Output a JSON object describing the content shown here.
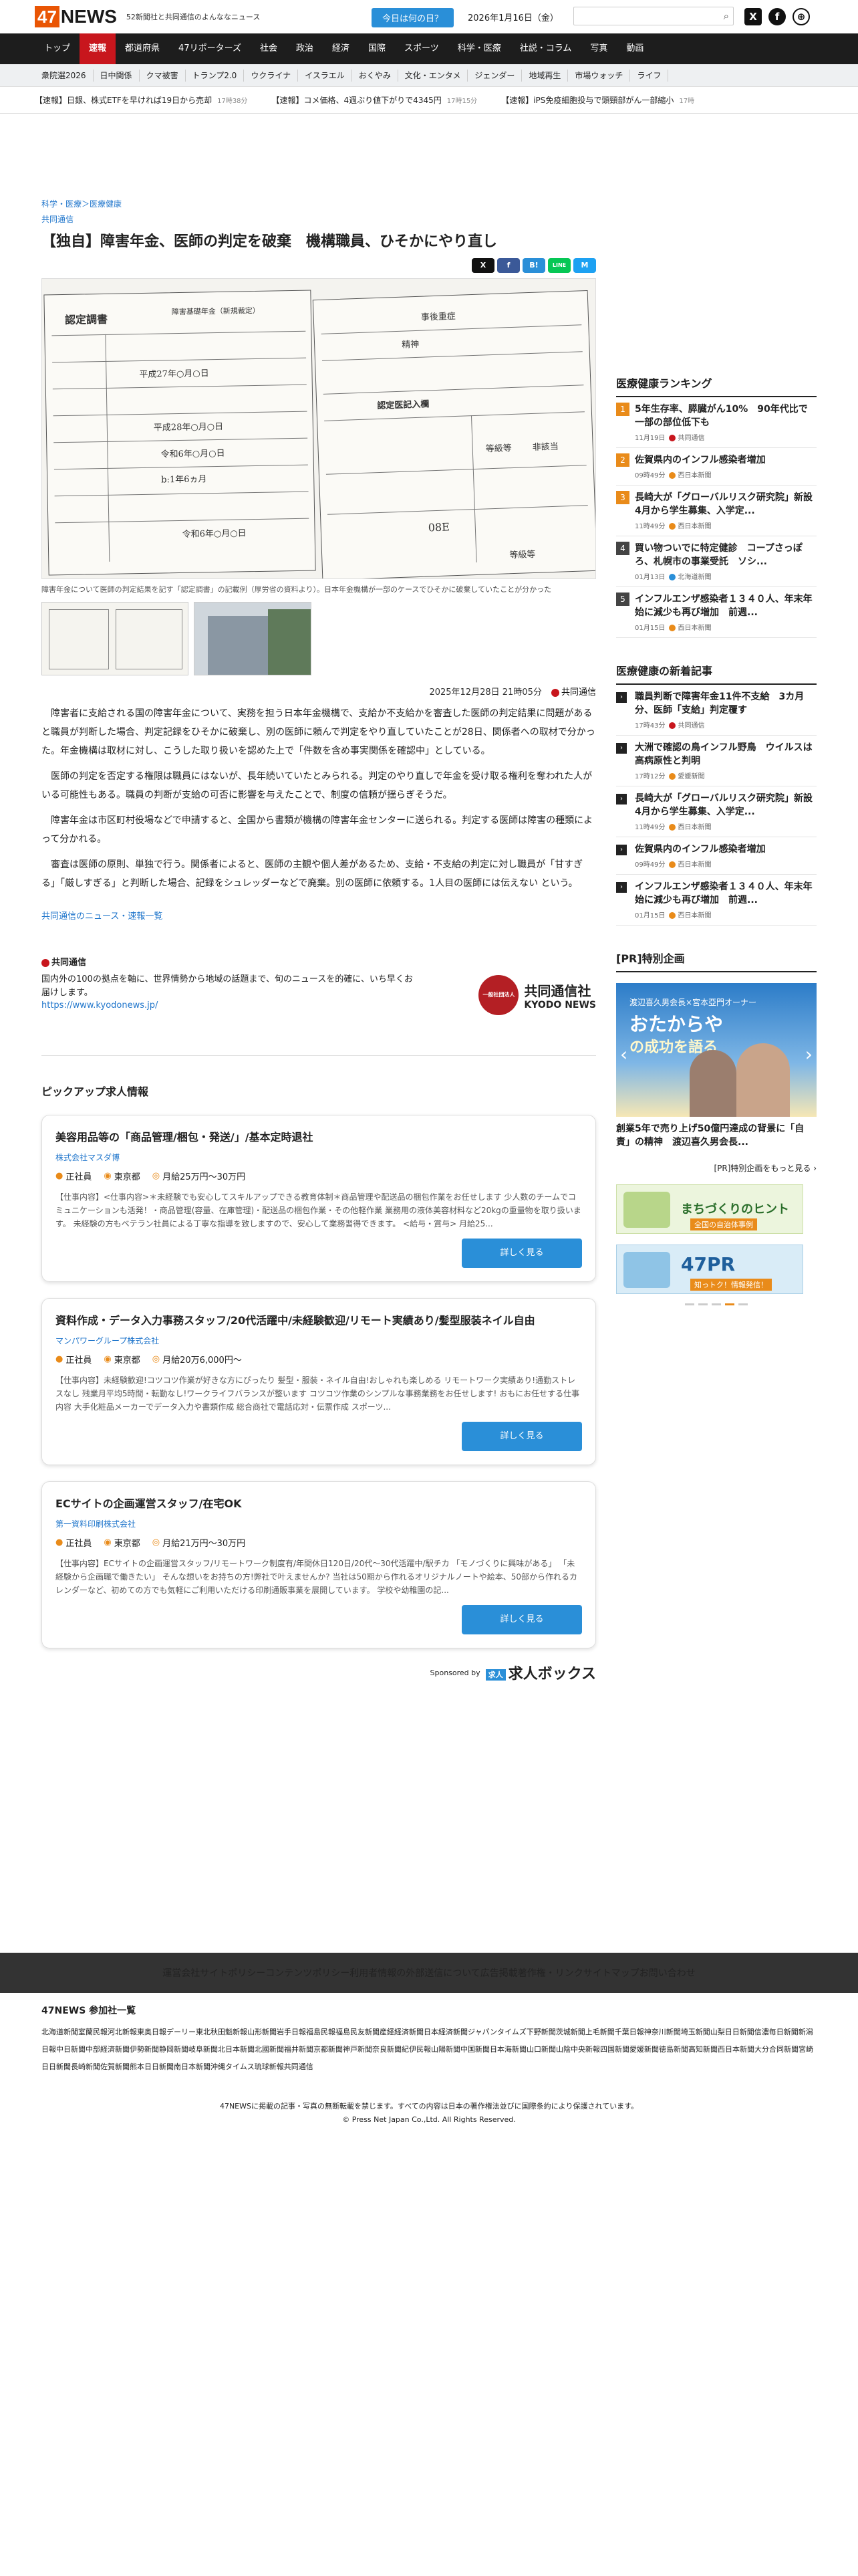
{
  "header": {
    "logo_num": "47",
    "logo_text": "NEWS",
    "tagline": "52新聞社と共同通信のよんななニュース",
    "today_button": "今日は何の日？",
    "date": "2026年1月16日（金）",
    "search_placeholder": ""
  },
  "nav_main": [
    "トップ",
    "速報",
    "都道府県",
    "47リポーターズ",
    "社会",
    "政治",
    "経済",
    "国際",
    "スポーツ",
    "科学・医療",
    "社説・コラム",
    "写真",
    "動画"
  ],
  "nav_active_index": 1,
  "nav_sub": [
    "衆院選2026",
    "日中関係",
    "クマ被害",
    "トランプ2.0",
    "ウクライナ",
    "イスラエル",
    "おくやみ",
    "文化・エンタメ",
    "ジェンダー",
    "地域再生",
    "市場ウォッチ",
    "ライフ"
  ],
  "ticker": [
    {
      "text": "【速報】日銀、株式ETFを早ければ19日から売却",
      "ago": "17時38分"
    },
    {
      "text": "【速報】コメ価格、4週ぶり値下がりで4345円",
      "ago": "17時15分"
    },
    {
      "text": "【速報】iPS免疫細胞投与で頭頸部がん一部縮小",
      "ago": "17時"
    }
  ],
  "article": {
    "breadcrumb": "科学・医療＞医療健康",
    "source": "共同通信",
    "title": "【独自】障害年金、医師の判定を破棄　機構職員、ひそかにやり直し",
    "share_buttons": [
      "X",
      "f",
      "B!",
      "LINE",
      "M"
    ],
    "hero_form_texts": {
      "title": "認定調書",
      "label1": "障害基礎年金（新規裁定）",
      "label2": "認定医記入欄",
      "row1": "平成27年○月○日",
      "row2": "平成28年○月○日",
      "row3": "令和6年○月○日",
      "row4": "b:1年6ヵ月",
      "row5": "令和6年○月○日",
      "right1": "事後重症",
      "right2": "精神",
      "right3": "等級等",
      "right4": "非該当",
      "right5": "08E",
      "right6": "等級等"
    },
    "caption": "障害年金について医師の判定結果を記す「認定調書」の記載例（厚労省の資料より）。日本年金機構が一部のケースでひそかに破棄していたことが分かった",
    "datetime": "2025年12月28日 21時05分",
    "datetime_source": "共同通信",
    "paragraphs": [
      "障害者に支給される国の障害年金について、実務を担う日本年金機構で、支給か不支給かを審査した医師の判定結果に問題があると職員が判断した場合、判定記録をひそかに破棄し、別の医師に頼んで判定をやり直していたことが28日、関係者への取材で分かった。年金機構は取材に対し、こうした取り扱いを認めた上で「件数を含め事実関係を確認中」としている。",
      "医師の判定を否定する権限は職員にはないが、長年続いていたとみられる。判定のやり直しで年金を受け取る権利を奪われた人がいる可能性もある。職員の判断が支給の可否に影響を与えたことで、制度の信頼が揺らぎそうだ。",
      "障害年金は市区町村役場などで申請すると、全国から書類が機構の障害年金センターに送られる。判定する医師は障害の種類によって分かれる。",
      "審査は医師の原則、単独で行う。関係者によると、医師の主観や個人差があるため、支給・不支給の判定に対し職員が「甘すぎる」「厳しすぎる」と判断した場合、記録をシュレッダーなどで廃棄。別の医師に依頼する。1人目の医師には伝えない という。"
    ],
    "more_link": "共同通信のニュース・速報一覧"
  },
  "provider": {
    "name": "共同通信",
    "desc": "国内外の100の拠点を軸に、世界情勢から地域の話題まで、旬のニュースを的確に、いち早くお届けします。",
    "url": "https://www.kyodonews.jp/",
    "logo_circle": "一般社団法人",
    "logo_jp": "共同通信社",
    "logo_en": "KYODO NEWS"
  },
  "jobs": {
    "heading": "ピックアップ求人情報",
    "button_label": "詳しく見る",
    "items": [
      {
        "title": "美容用品等の「商品管理/梱包・発送/」/基本定時退社",
        "company": "株式会社マスダ博",
        "type": "正社員",
        "place": "東京都",
        "salary": "月給25万円〜30万円",
        "desc": "【仕事内容】<仕事内容>＊未経験でも安心してスキルアップできる教育体制＊商品管理や配送品の梱包作業をお任せします 少人数のチームでコミュニケーションも活発！・商品管理(容量、在庫管理)・配送品の梱包作業・その他軽作業 業務用の液体美容材料など20kgの重量物を取り扱います。 未経験の方もベテラン社員による丁寧な指導を致しますので、安心して業務習得できます。 <給与・賞与> 月給25..."
      },
      {
        "title": "資料作成・データ入力事務スタッフ/20代活躍中/未経験歓迎/リモート実績あり/髪型服装ネイル自由",
        "company": "マンパワーグループ株式会社",
        "type": "正社員",
        "place": "東京都",
        "salary": "月給20万6,000円〜",
        "desc": "【仕事内容】未経験歓迎!コツコツ作業が好きな方にぴったり 髪型・服装・ネイル自由!おしゃれも楽しめる リモートワーク実績あり!通勤ストレスなし 残業月平均5時間・転勤なし!ワークライフバランスが整います コツコツ作業のシンプルな事務業務をお任せします! おもにお任せする仕事内容 大手化粧品メーカーでデータ入力や書類作成 総合商社で電話応対・伝票作成 スポーツ..."
      },
      {
        "title": "ECサイトの企画運営スタッフ/在宅OK",
        "company": "第一資料印刷株式会社",
        "type": "正社員",
        "place": "東京都",
        "salary": "月給21万円〜30万円",
        "desc": "【仕事内容】ECサイトの企画運営スタッフ/リモートワーク制度有/年間休日120日/20代〜30代活躍中/駅チカ 「モノづくりに興味がある」 「未経験から企画職で働きたい」 そんな想いをお持ちの方!弊社で叶えませんか? 当社は50期から作れるオリジナルノートや絵本、50部から作れるカレンダーなど、初めての方でも気軽にご利用いただける印刷通販事業を展開しています。 学校や幼稚園の記..."
      }
    ],
    "sponsored_by": "Sponsored by",
    "sponsor_mark": "求人",
    "sponsor_name": "求人ボックス"
  },
  "sidebar": {
    "ranking_title": "医療健康ランキング",
    "ranking": [
      {
        "rank": "1",
        "title": "5年生存率、膵臓がん10%　90年代比で一部の部位低下も",
        "time": "11月19日",
        "source": "共同通信",
        "dot": "#c8161d"
      },
      {
        "rank": "2",
        "title": "佐賀県内のインフル感染者増加",
        "time": "09時49分",
        "source": "西日本新聞",
        "dot": "#e98b1a"
      },
      {
        "rank": "3",
        "title": "長崎大が「グローバルリスク研究院」新設　4月から学生募集、入学定...",
        "time": "11時49分",
        "source": "西日本新聞",
        "dot": "#e98b1a"
      },
      {
        "rank": "4",
        "title": "買い物ついでに特定健診　コープさっぽろ、札幌市の事業受託　ソシ...",
        "time": "01月13日",
        "source": "北海道新聞",
        "dot": "#2a8fd8"
      },
      {
        "rank": "5",
        "title": "インフルエンザ感染者１３４０人、年末年始に減少も再び増加　前週...",
        "time": "01月15日",
        "source": "西日本新聞",
        "dot": "#e98b1a"
      }
    ],
    "new_title": "医療健康の新着記事",
    "new": [
      {
        "title": "職員判断で障害年金11件不支給　3カ月分、医師「支給」判定覆す",
        "time": "17時43分",
        "source": "共同通信",
        "dot": "#c8161d"
      },
      {
        "title": "大洲で確認の鳥インフル野鳥　ウイルスは高病原性と判明",
        "time": "17時12分",
        "source": "愛媛新聞",
        "dot": "#e98b1a"
      },
      {
        "title": "長崎大が「グローバルリスク研究院」新設　4月から学生募集、入学定...",
        "time": "11時49分",
        "source": "西日本新聞",
        "dot": "#e98b1a"
      },
      {
        "title": "佐賀県内のインフル感染者増加",
        "time": "09時49分",
        "source": "西日本新聞",
        "dot": "#e98b1a"
      },
      {
        "title": "インフルエンザ感染者１３４０人、年末年始に減少も再び増加　前週...",
        "time": "01月15日",
        "source": "西日本新聞",
        "dot": "#e98b1a"
      }
    ],
    "pr_title": "[PR]特別企画",
    "pr_card_line1": "渡辺喜久男会長×宮本亞門オーナー",
    "pr_card_line2": "おたからや",
    "pr_card_line3": "の成功を語る",
    "pr_article": "創業5年で売り上げ50億円達成の背景に「自責」の精神　渡辺喜久男会長...",
    "pr_more": "[PR]特別企画をもっと見る ›",
    "banner1": "まちづくりのヒント",
    "banner1_sub": "全国の自治体事例",
    "banner2": "47PR",
    "banner2_sub": "知っトク！情報発信！"
  },
  "footer": {
    "links": [
      "運営会社",
      "サイトポリシー",
      "コンテンツポリシー",
      "利用者情報の外部送信について",
      "広告掲載",
      "著作権・リンク",
      "サイトマップ",
      "お問い合わせ"
    ],
    "members_title": "47NEWS 参加社一覧",
    "members": [
      "北海道新聞",
      "室蘭民報",
      "河北新報",
      "東奥日報",
      "デーリー東北",
      "秋田魁新報",
      "山形新聞",
      "岩手日報",
      "福島民報",
      "福島民友新聞",
      "産経経済新聞",
      "日本経済新聞",
      "ジャパンタイムズ",
      "下野新聞",
      "茨城新聞",
      "上毛新聞",
      "千葉日報",
      "神奈川新聞",
      "埼玉新聞",
      "山梨日日新聞",
      "信濃毎日新聞",
      "新潟日報",
      "中日新聞",
      "中部経済新聞",
      "伊勢新聞",
      "静岡新聞",
      "岐阜新聞",
      "北日本新聞",
      "北國新聞",
      "福井新聞",
      "京都新聞",
      "神戸新聞",
      "奈良新聞",
      "紀伊民報",
      "山陽新聞",
      "中国新聞",
      "日本海新聞",
      "山口新聞",
      "山陰中央新報",
      "四国新聞",
      "愛媛新聞",
      "徳島新聞",
      "高知新聞",
      "西日本新聞",
      "大分合同新聞",
      "宮崎日日新聞",
      "長崎新聞",
      "佐賀新聞",
      "熊本日日新聞",
      "南日本新聞",
      "沖縄タイムス",
      "琉球新報",
      "共同通信"
    ],
    "copy1": "47NEWSに掲載の記事・写真の無断転載を禁じます。すべての内容は日本の著作権法並びに国際条約により保護されています。",
    "copy2": "© Press Net Japan Co.,Ltd. All Rights Reserved."
  }
}
